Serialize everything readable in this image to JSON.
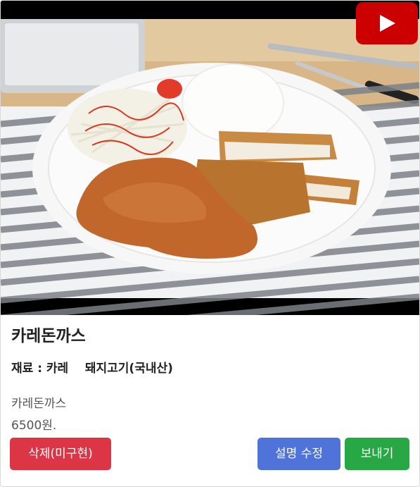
{
  "card": {
    "title": "카레돈까스",
    "ingredients": "재료 : 카레    돼지고기(국내산)",
    "description": "카레돈까스",
    "price": "6500원."
  },
  "media": {
    "play_icon": "youtube-play-icon",
    "play_color": "#cc0000"
  },
  "buttons": {
    "delete_label": "삭제(미구현)",
    "edit_label": "설명 수정",
    "send_label": "보내기",
    "delete_color": "#dc3545",
    "edit_color": "#4f73d9",
    "send_color": "#28a745"
  }
}
